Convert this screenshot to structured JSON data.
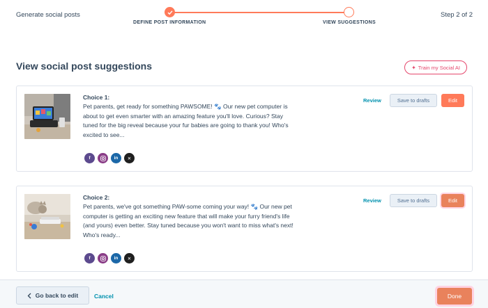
{
  "header": {
    "app_title": "Generate social posts",
    "step_info": "Step 2 of 2",
    "steps": [
      {
        "label": "DEFINE POST INFORMATION",
        "state": "complete"
      },
      {
        "label": "VIEW SUGGESTIONS",
        "state": "active"
      }
    ]
  },
  "main": {
    "title": "View social post suggestions",
    "train_button": "Train my Social AI",
    "choices": [
      {
        "title": "Choice 1:",
        "text": "Pet parents, get ready for something PAWSOME! 🐾 Our new pet computer is about to get even smarter with an amazing feature you'll love. Curious? Stay tuned for the big reveal because your fur babies are going to thank you! Who's excited to see...",
        "image": "pet-computer-tablet-photo",
        "review": "Review",
        "save": "Save to drafts",
        "edit": "Edit",
        "socials": [
          "facebook-icon",
          "instagram-icon",
          "linkedin-icon",
          "x-icon"
        ]
      },
      {
        "title": "Choice 2:",
        "text": "Pet parents, we've got something PAW-some coming your way! 🐾 Our new pet computer is getting an exciting new feature that will make your furry friend's life (and yours) even better. Stay tuned because you won't want to miss what's next! Who's ready...",
        "image": "cat-with-pet-device-photo",
        "review": "Review",
        "save": "Save to drafts",
        "edit": "Edit",
        "socials": [
          "facebook-icon",
          "instagram-icon",
          "linkedin-icon",
          "x-icon"
        ]
      }
    ]
  },
  "footer": {
    "back": "Go back to edit",
    "cancel": "Cancel",
    "done": "Done"
  },
  "colors": {
    "accent": "#ff7a59",
    "link": "#0091ae",
    "text": "#33475b",
    "pink": "#e5476c"
  }
}
